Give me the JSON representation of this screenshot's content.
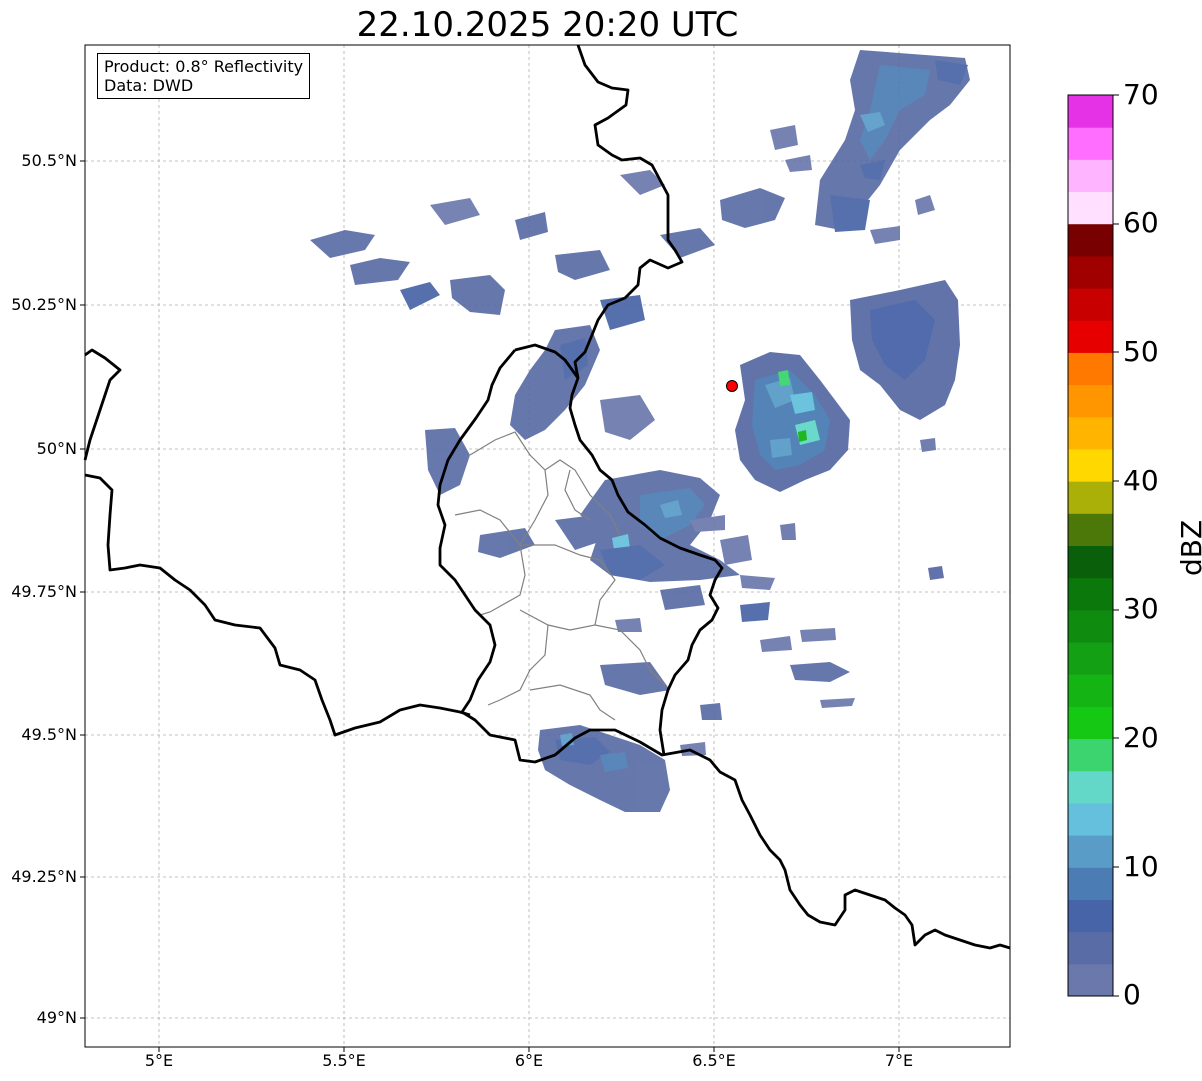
{
  "title": "22.10.2025 20:20 UTC",
  "info": {
    "product": "Product: 0.8° Reflectivity",
    "source": "Data: DWD"
  },
  "axes": {
    "lat_ticks": [
      "50.5°N",
      "50.25°N",
      "50°N",
      "49.75°N",
      "49.5°N",
      "49.25°N",
      "49°N"
    ],
    "lon_ticks": [
      "5°E",
      "5.5°E",
      "6°E",
      "6.5°E",
      "7°E"
    ]
  },
  "colorbar": {
    "label": "dBZ",
    "ticks": [
      "0",
      "10",
      "20",
      "30",
      "40",
      "50",
      "60",
      "70"
    ],
    "colors": [
      "#6a78ac",
      "#5a6ca6",
      "#4864a8",
      "#4b7db4",
      "#5a9cc8",
      "#64c0dc",
      "#64d8c8",
      "#3cd46e",
      "#14c814",
      "#14b414",
      "#14a014",
      "#0f8c0f",
      "#0a780a",
      "#0a5f0a",
      "#4b7808",
      "#aab008",
      "#ffd800",
      "#ffb400",
      "#ff9600",
      "#ff7800",
      "#e60000",
      "#c80000",
      "#a00000",
      "#780000",
      "#ffe0ff",
      "#ffb4ff",
      "#ff6eff",
      "#e632e6"
    ]
  },
  "radar_marker": {
    "lat": 50.11,
    "lon": 6.55,
    "color": "#ff0000"
  },
  "map_extent": {
    "lon": [
      4.8,
      7.3
    ],
    "lat": [
      48.95,
      50.7
    ]
  }
}
